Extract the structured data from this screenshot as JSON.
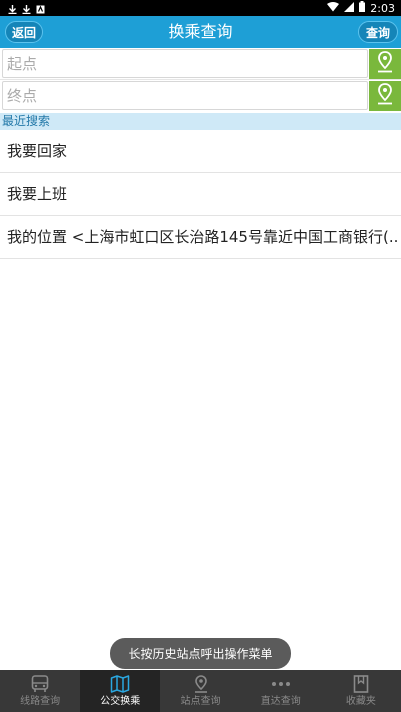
{
  "status_bar": {
    "time": "2:03"
  },
  "header": {
    "back_label": "返回",
    "title": "换乘查询",
    "query_label": "查询"
  },
  "inputs": {
    "start_placeholder": "起点",
    "end_placeholder": "终点"
  },
  "recent": {
    "header": "最近搜索",
    "items": [
      {
        "label": "我要回家"
      },
      {
        "label": "我要上班"
      },
      {
        "label": "我的位置 <上海市虹口区长治路145号靠近中国工商银行(.."
      }
    ]
  },
  "toast": "长按历史站点呼出操作菜单",
  "bottom_nav": {
    "items": [
      {
        "label": "线路查询",
        "icon": "bus-icon"
      },
      {
        "label": "公交换乘",
        "icon": "map-icon",
        "active": true
      },
      {
        "label": "站点查询",
        "icon": "location-pin-icon"
      },
      {
        "label": "直达查询",
        "icon": "more-dots-icon"
      },
      {
        "label": "收藏夹",
        "icon": "bookmark-icon"
      }
    ]
  },
  "colors": {
    "header": "#1e9fd6",
    "locate": "#7ab83c",
    "recent_header_bg": "#cfe9f7",
    "nav_bg": "#383838"
  }
}
